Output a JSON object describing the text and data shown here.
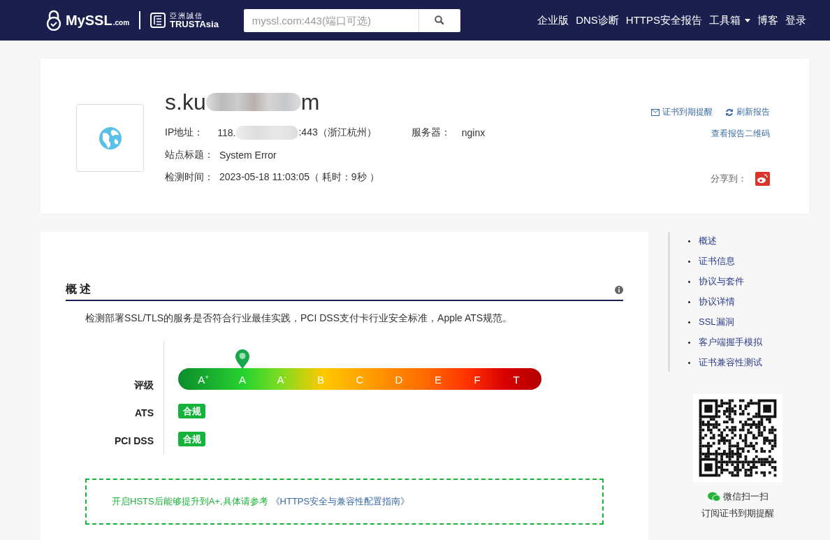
{
  "nav": {
    "logo": {
      "brand": "MySSL",
      "suffix": ".com",
      "partner_cn": "亞洲誠信",
      "partner_en": "TRUSTAsia"
    },
    "search": {
      "placeholder": "myssl.com:443(端口可选)"
    },
    "links": [
      {
        "label": "企业版",
        "dropdown": false
      },
      {
        "label": "DNS诊断",
        "dropdown": false
      },
      {
        "label": "HTTPS安全报告",
        "dropdown": false
      },
      {
        "label": "工具箱",
        "dropdown": true
      },
      {
        "label": "博客",
        "dropdown": false
      },
      {
        "label": "登录",
        "dropdown": false
      }
    ]
  },
  "site": {
    "domain_start": "s.ku",
    "domain_end": "m",
    "ip_label": "IP地址：",
    "ip_start": "118.",
    "ip_end": ":443（浙江杭州）",
    "server_label": "服务器：",
    "server": "nginx",
    "title_label": "站点标题：",
    "title": "System Error",
    "time_label": "检测时间：",
    "time": "2023-05-18 11:03:05（ 耗时：9秒 ）"
  },
  "actions": [
    {
      "label": "证书到期提醒"
    },
    {
      "label": "刷新报告"
    }
  ],
  "qr_link": "查看报告二维码",
  "share_label": "分享到：",
  "overview": {
    "title": "概 述",
    "description": "检测部署SSL/TLS的服务是否符合行业最佳实践，PCI DSS支付卡行业安全标准，Apple ATS规范。",
    "rating_label": "评级",
    "grades": [
      {
        "label": "A$^{+}$",
        "selected": false
      },
      {
        "label": "A",
        "selected": true
      },
      {
        "label": "A$^{-}$",
        "selected": false
      },
      {
        "label": "B",
        "selected": false
      },
      {
        "label": "C",
        "selected": false
      },
      {
        "label": "D",
        "selected": false
      },
      {
        "label": "E",
        "selected": false
      },
      {
        "label": "F",
        "selected": false
      },
      {
        "label": "T",
        "selected": false
      }
    ],
    "compliance": [
      {
        "label": "ATS",
        "status": "合规"
      },
      {
        "label": "PCI DSS",
        "status": "合规"
      }
    ],
    "tip": {
      "text": "开启HSTS后能够提升到A+,具体请参考",
      "link": "《HTTPS安全与兼容性配置指南》"
    }
  },
  "toc": [
    {
      "label": "概述"
    },
    {
      "label": "证书信息"
    },
    {
      "label": "协议与套件"
    },
    {
      "label": "协议详情"
    },
    {
      "label": "SSL漏洞"
    },
    {
      "label": "客户端握手模拟"
    },
    {
      "label": "证书兼容性测试"
    }
  ],
  "qr": {
    "caption": "微信扫一扫",
    "subtitle": "订阅证书到期提醒"
  }
}
